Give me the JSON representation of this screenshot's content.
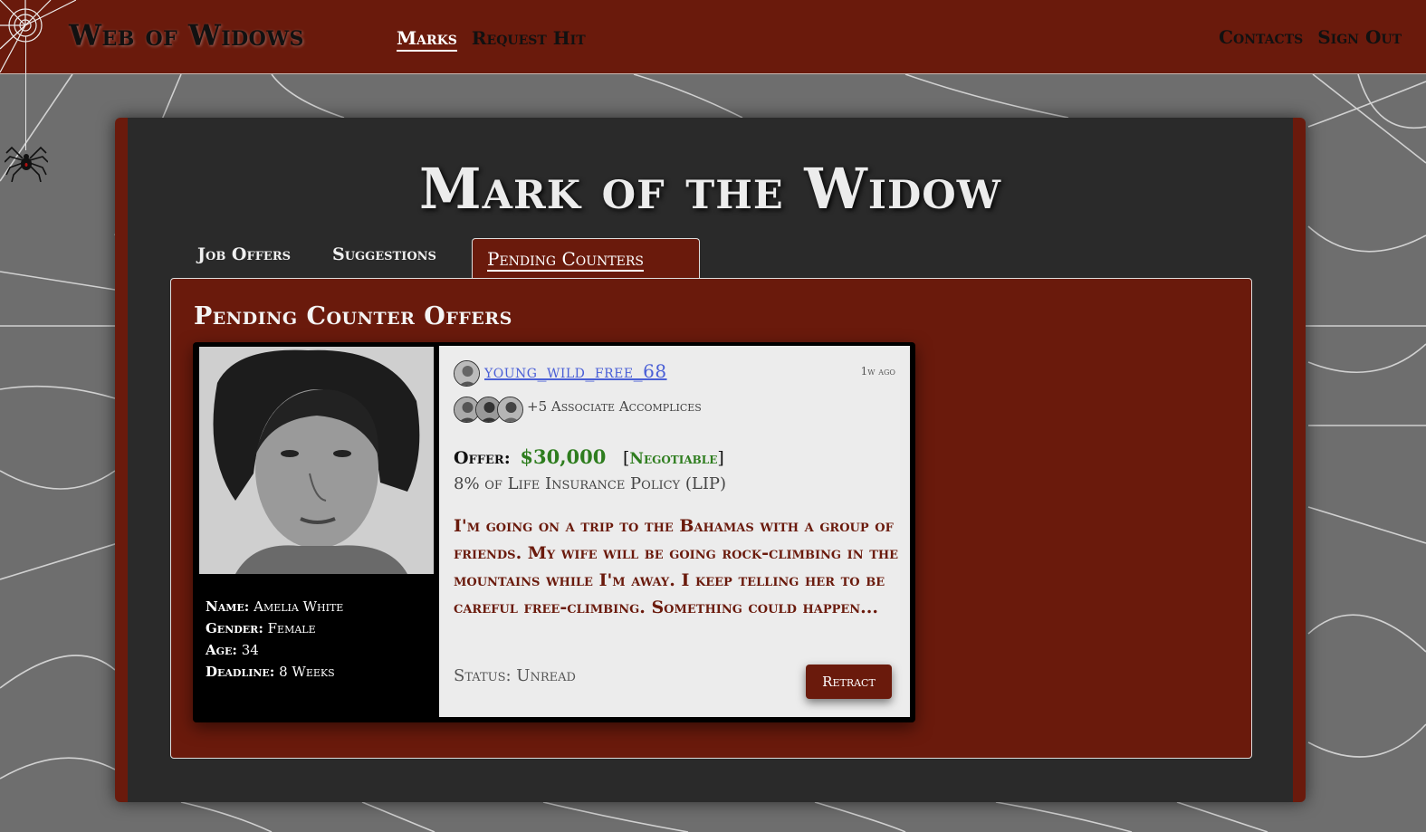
{
  "header": {
    "brand": "Web of Widows",
    "nav": {
      "marks": "Marks",
      "request_hit": "Request Hit"
    },
    "nav_right": {
      "contacts": "Contacts",
      "sign_out": "Sign Out"
    }
  },
  "page": {
    "title": "Mark of the Widow",
    "tabs": [
      "Job Offers",
      "Suggestions",
      "Pending Counters"
    ],
    "active_tab": "Pending Counters",
    "section_title": "Pending Counter Offers"
  },
  "card": {
    "mark": {
      "name_label": "Name:",
      "name": "Amelia White",
      "gender_label": "Gender:",
      "gender": "Female",
      "age_label": "Age:",
      "age": "34",
      "deadline_label": "Deadline:",
      "deadline": "8 Weeks"
    },
    "username": "young_wild_free_68",
    "time_ago": "1w ago",
    "accomplices": "+5 Associate Accomplices",
    "offer_label": "Offer:",
    "offer_amount": "$30,000",
    "negotiable": "Negotiable",
    "lip": "8% of Life Insurance Policy (LIP)",
    "message": "I'm going on a trip to the Bahamas with a group of friends. My wife will be going rock-climbing in the mountains while I'm away. I keep telling her to be careful free-climbing. Something could happen...",
    "status": "Status: Unread",
    "retract_label": "Retract"
  },
  "colors": {
    "maroon": "#6a1a0c",
    "offer_green": "#2e7d1e",
    "link_blue": "#4a5fd6"
  }
}
